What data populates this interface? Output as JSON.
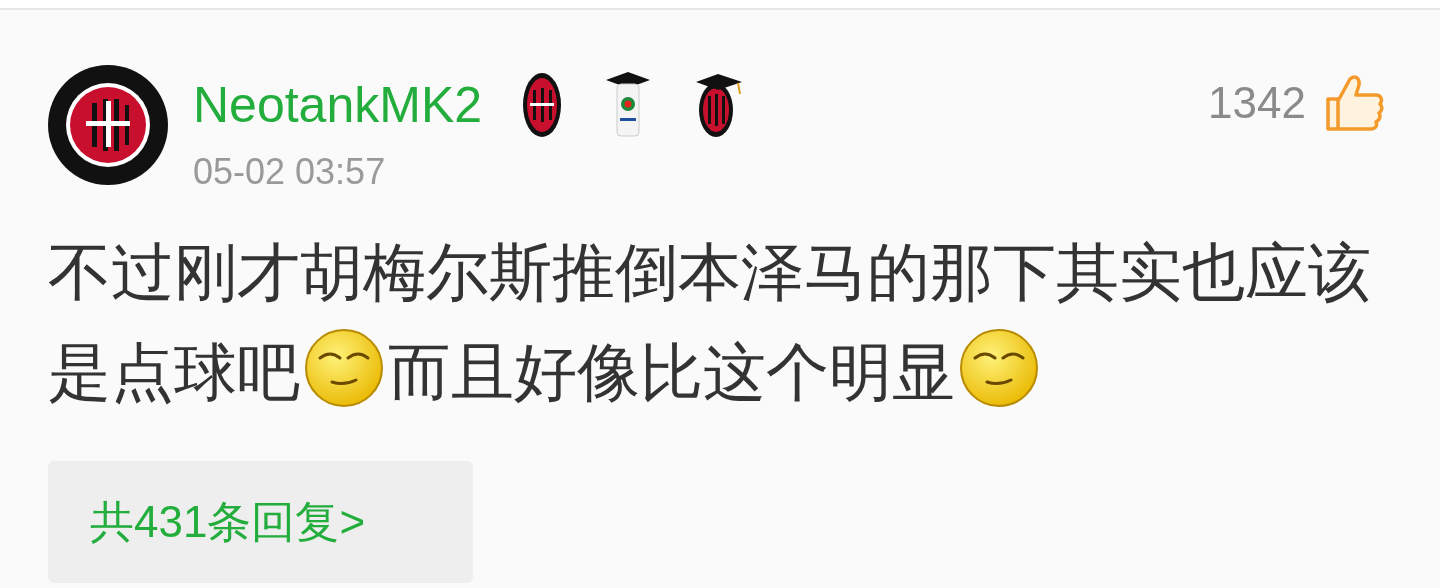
{
  "comment": {
    "username": "NeotankMK2",
    "badges": [
      {
        "kind": "club"
      },
      {
        "kind": "league"
      },
      {
        "kind": "club-graduate"
      }
    ],
    "time": "05-02 03:57",
    "likes": "1342",
    "content": [
      {
        "kind": "text",
        "text": "不过刚才胡梅尔斯推倒本泽马的那下其实也应该是点球吧"
      },
      {
        "kind": "emoji"
      },
      {
        "kind": "text",
        "text": "而且好像比这个明显"
      },
      {
        "kind": "emoji"
      }
    ],
    "replies": "共431条回复>"
  }
}
